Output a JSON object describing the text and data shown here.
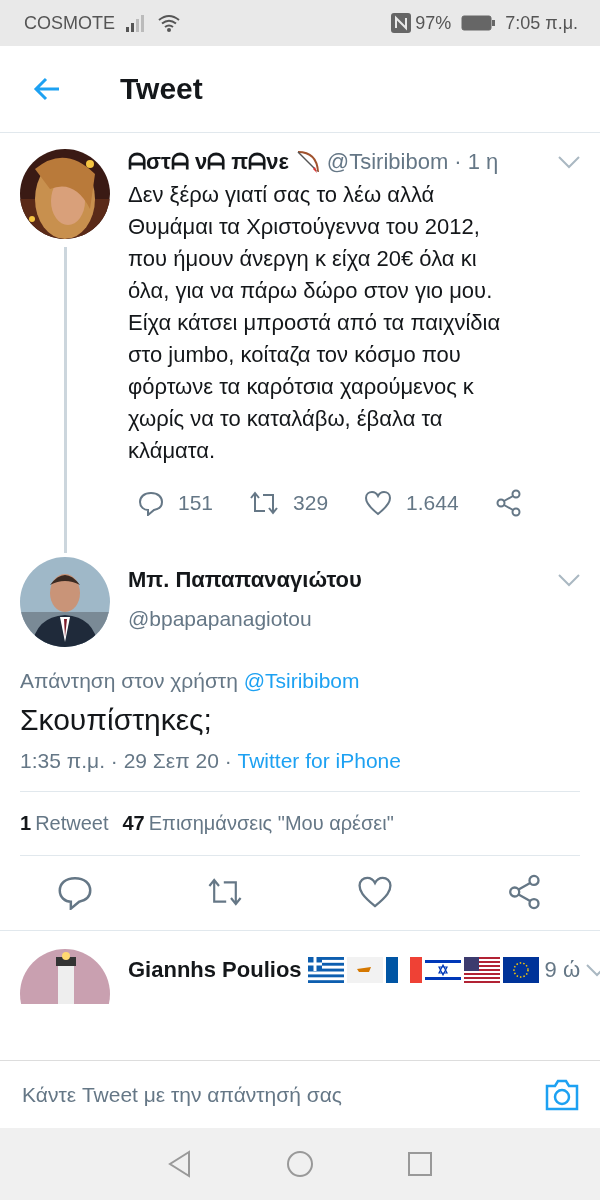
{
  "status_bar": {
    "carrier": "COSMOTE",
    "battery": "97%",
    "time": "7:05 π.μ."
  },
  "header": {
    "title": "Tweet"
  },
  "parent_tweet": {
    "name": "ᗩστᗩ νᗩ πᗩνε",
    "handle": "@Tsiribibom",
    "time": "· 1 η",
    "text": "Δεν ξέρω γιατί σας το λέω αλλά Θυμάμαι τα Χριστούγεννα του 2012, που ήμουν άνεργη κ είχα 20€ όλα κι όλα, για να πάρω δώρο στον γιο μου. Είχα κάτσει μπροστά από τα παιχνίδια στο jumbo, κοίταζα τον κόσμο που φόρτωνε τα καρότσια χαρούμενος κ χωρίς να το καταλάβω, έβαλα τα κλάματα.",
    "replies": "151",
    "retweets": "329",
    "likes": "1.644"
  },
  "main_tweet": {
    "name": "Μπ. Παπαπαναγιώτου",
    "handle": "@bpapapanagiotou",
    "reply_to_label": "Απάντηση στον χρήστη",
    "reply_to_handle": "@Tsiribibom",
    "text": "Σκουπίστηκες;",
    "date": "1:35 π.μ. · 29 Σεπ 20 ·",
    "source": "Twitter for iPhone",
    "retweet_count": "1",
    "retweet_label": "Retweet",
    "like_count": "47",
    "like_label": "Επισημάνσεις \"Μου αρέσει\""
  },
  "next_reply": {
    "name": "Giannhs Poulios",
    "time": "9 ώ"
  },
  "reply_bar": {
    "placeholder": "Κάντε Tweet με την απάντησή σας"
  }
}
